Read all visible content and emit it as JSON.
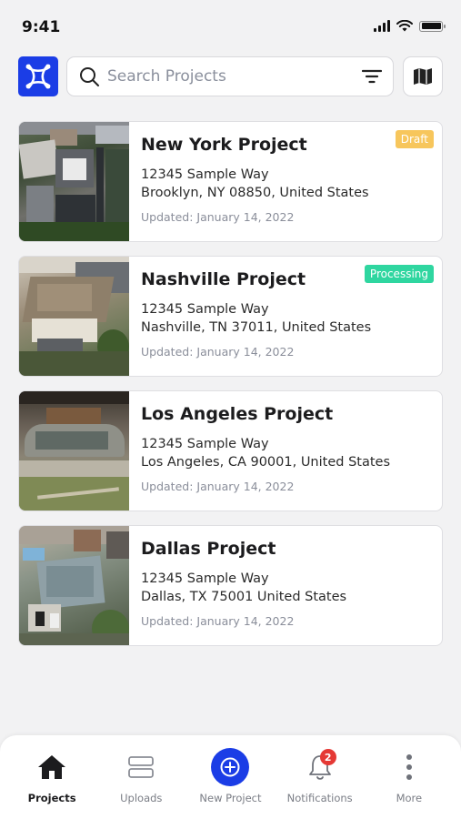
{
  "status_bar": {
    "time": "9:41"
  },
  "search": {
    "placeholder": "Search Projects"
  },
  "projects": [
    {
      "title": "New York Project",
      "address_line1": "12345 Sample Way",
      "address_line2": "Brooklyn, NY 08850, United States",
      "updated": "Updated: January 14, 2022",
      "badge": "Draft",
      "badge_color": "#f7c65c"
    },
    {
      "title": "Nashville Project",
      "address_line1": "12345 Sample Way",
      "address_line2": "Nashville, TN 37011, United States",
      "updated": "Updated: January 14, 2022",
      "badge": "Processing",
      "badge_color": "#2fd6a0"
    },
    {
      "title": "Los Angeles Project",
      "address_line1": "12345 Sample Way",
      "address_line2": "Los Angeles, CA 90001, United States",
      "updated": "Updated: January 14, 2022",
      "badge": "",
      "badge_color": ""
    },
    {
      "title": "Dallas Project",
      "address_line1": "12345 Sample Way",
      "address_line2": "Dallas, TX 75001 United States",
      "updated": "Updated: January 14, 2022",
      "badge": "",
      "badge_color": ""
    }
  ],
  "tab_bar": {
    "items": [
      {
        "label": "Projects",
        "icon": "home-icon",
        "active": true
      },
      {
        "label": "Uploads",
        "icon": "uploads-icon",
        "active": false
      },
      {
        "label": "New Project",
        "icon": "add-circle-icon",
        "active": false
      },
      {
        "label": "Notifications",
        "icon": "bell-icon",
        "active": false,
        "badge": "2"
      },
      {
        "label": "More",
        "icon": "more-vertical-icon",
        "active": false
      }
    ]
  },
  "colors": {
    "brand": "#1b3de6",
    "draft": "#f7c65c",
    "processing": "#2fd6a0",
    "notification": "#e53935"
  }
}
